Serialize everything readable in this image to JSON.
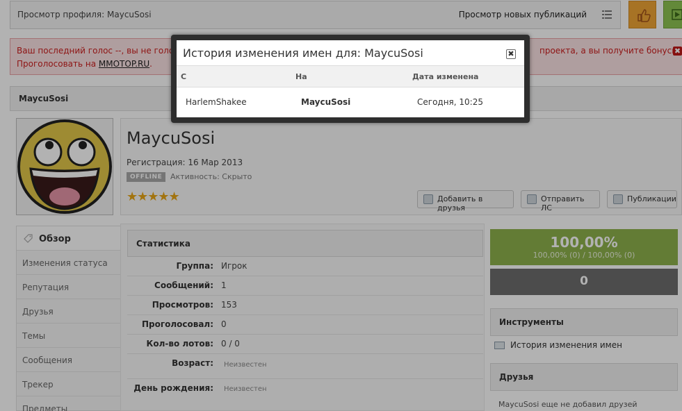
{
  "topbar": {
    "breadcrumb": "Просмотр профиля: MaycuSosi",
    "new_publications": "Просмотр новых публикаций"
  },
  "alert": {
    "line1_left": "Ваш последний голос --, вы не голосо",
    "line1_right": "проекта, а вы получите бонусы.",
    "line2_prefix": "Проголосовать на ",
    "link": "MMOTOP.RU",
    "line2_suffix": ".",
    "close": "✖"
  },
  "profile": {
    "namebar": "MaycuSosi",
    "name": "MaycuSosi",
    "registration": "Регистрация: 16 Мар 2013",
    "status_badge": "OFFLINE",
    "activity": "Активность: Скрыто",
    "stars": "★★★★★",
    "buttons": {
      "add_friend": "Добавить в друзья",
      "send_pm": "Отправить ЛС",
      "publications": "Публикации"
    }
  },
  "nav": {
    "items": [
      {
        "label": "Обзор"
      },
      {
        "label": "Изменения статуса"
      },
      {
        "label": "Репутация"
      },
      {
        "label": "Друзья"
      },
      {
        "label": "Темы"
      },
      {
        "label": "Сообщения"
      },
      {
        "label": "Трекер"
      },
      {
        "label": "Предметы"
      }
    ]
  },
  "stats": {
    "title": "Статистика",
    "rows": [
      {
        "label": "Группа:",
        "value": "Игрок"
      },
      {
        "label": "Сообщений:",
        "value": "1"
      },
      {
        "label": "Просмотров:",
        "value": "153"
      },
      {
        "label": "Проголосовал:",
        "value": "0"
      },
      {
        "label": "Кол-во лотов:",
        "value": "0 / 0"
      },
      {
        "label": "Возраст:",
        "value": "Неизвестен"
      },
      {
        "label": "День рождения:",
        "value": "Неизвестен"
      }
    ]
  },
  "right": {
    "rep_big": "100,00%",
    "rep_small": "100,00% (0)  /  100,00% (0)",
    "zero": "0",
    "tools_title": "Инструменты",
    "tool_link": "История изменения имен",
    "friends_title": "Друзья",
    "friends_note": "MaycuSosi еще не добавил друзей"
  },
  "modal": {
    "title": "История изменения имен для: MaycuSosi",
    "close": "✖",
    "columns": {
      "from": "С",
      "to": "На",
      "date": "Дата изменена"
    },
    "rows": [
      {
        "from": "HarlemShakee",
        "to": "MaycuSosi",
        "date": "Сегодня, 10:25"
      }
    ]
  },
  "colors": {
    "accent_orange": "#f0a536",
    "accent_green": "#8fc552",
    "rep_green": "#8fb24d",
    "alert_red": "#cc1e1e"
  }
}
